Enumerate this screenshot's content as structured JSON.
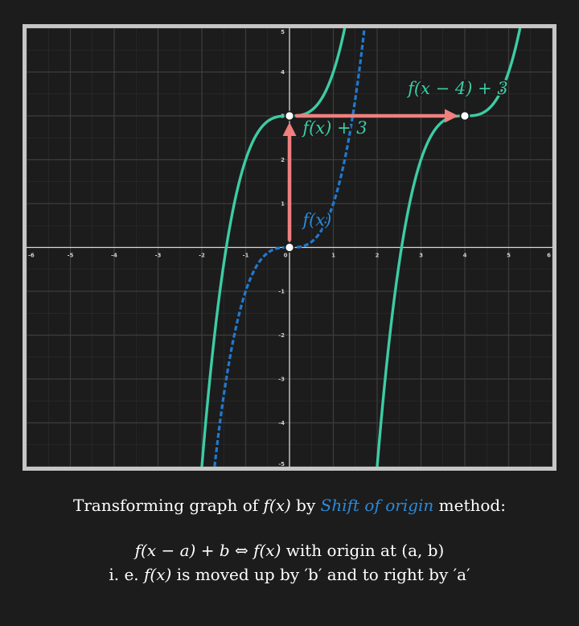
{
  "colors": {
    "background": "#1c1c1c",
    "frame": "#c6c6c6",
    "grid": "#3d3d3d",
    "axis": "#d8d8d8",
    "tick_label": "#cfcfcf",
    "blue": "#1f7ad0",
    "green": "#3dcca4",
    "arrow": "#f08080",
    "point_fill": "#ffffff"
  },
  "chart_data": {
    "type": "line",
    "xlim": [
      -6,
      6
    ],
    "ylim": [
      -5,
      5
    ],
    "grid": true,
    "x_ticks": [
      "-6",
      "-5",
      "-4",
      "-3",
      "-2",
      "-1",
      "0",
      "1",
      "2",
      "3",
      "4",
      "5",
      "6"
    ],
    "y_ticks": [
      "5",
      "4",
      "3",
      "2",
      "1",
      "-1",
      "-2",
      "-3",
      "-4",
      "-5"
    ],
    "series": [
      {
        "name": "f(x)",
        "expression": "x^3",
        "style": "dashed",
        "color": "#1f7ad0"
      },
      {
        "name": "f(x) + 3",
        "expression": "x^3 + 3",
        "style": "solid",
        "color": "#3dcca4"
      },
      {
        "name": "f(x − 4) + 3",
        "expression": "(x-4)^3 + 3",
        "style": "solid",
        "color": "#3dcca4"
      }
    ],
    "arrows": [
      {
        "from": [
          0,
          0
        ],
        "to": [
          0,
          3
        ]
      },
      {
        "from": [
          0,
          3
        ],
        "to": [
          4,
          3
        ]
      }
    ],
    "points": [
      [
        0,
        0
      ],
      [
        0,
        3
      ],
      [
        4,
        3
      ]
    ],
    "labels": [
      {
        "text": "f(x)",
        "at": [
          0.3,
          0.5
        ],
        "color": "#2a8ad8"
      },
      {
        "text": "f(x) + 3",
        "at": [
          0.3,
          2.6
        ],
        "color": "#3dcca4"
      },
      {
        "text": "f(x − 4) + 3",
        "at": [
          2.7,
          3.5
        ],
        "color": "#3dcca4"
      }
    ]
  },
  "caption": {
    "line1_prefix": "Transforming graph of ",
    "line1_func": "f(x)",
    "line1_by": " by ",
    "line1_method": "Shift of origin",
    "line1_suffix": " method:",
    "line2_expr": "f(x − a) + b  ⇔ f(x)",
    "line2_suffix": " with origin at (a, b)",
    "line3_prefix": "i. e. ",
    "line3_func": "f(x)",
    "line3_suffix": " is moved up by ′b′ and to right by ′a′"
  }
}
